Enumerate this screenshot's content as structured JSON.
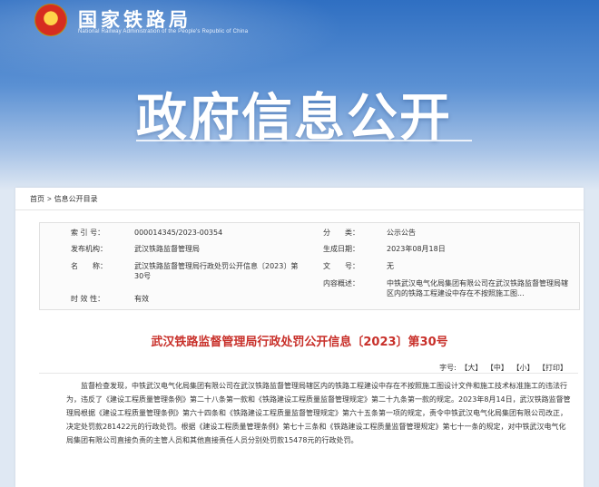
{
  "header": {
    "brand_cn": "国家铁路局",
    "brand_en": "National Railway Administration of the People's Republic of China",
    "page_title": "政府信息公开"
  },
  "breadcrumb": [
    "首页",
    ">",
    "信息公开目录"
  ],
  "meta": {
    "index_label": "索 引 号：",
    "index_value": "000014345/2023-00354",
    "category_label": "分　　类：",
    "category_value": "公示公告",
    "issuer_label": "发布机构：",
    "issuer_value": "武汉铁路监督管理局",
    "date_label": "生成日期：",
    "date_value": "2023年08月18日",
    "name_label": "名　　称：",
    "name_value": "武汉铁路监督管理局行政处罚公开信息〔2023〕第30号",
    "docno_label": "文　　号：",
    "docno_value": "无",
    "summary_label": "内容概述：",
    "summary_value": "中铁武汉电气化局集团有限公司在武汉铁路监督管理局辖区内的铁路工程建设中存在不按照施工图...",
    "validity_label": "时 效 性：",
    "validity_value": "有效"
  },
  "document": {
    "title": "武汉铁路监督管理局行政处罚公开信息〔2023〕第30号",
    "font_label": "字号:",
    "font_large": "【大】",
    "font_medium": "【中】",
    "font_small": "【小】",
    "print": "【打印】",
    "paragraph": "监督检查发现，中铁武汉电气化局集团有限公司在武汉铁路监督管理局辖区内的铁路工程建设中存在不按照施工图设计文件和施工技术标准施工的违法行为，违反了《建设工程质量管理条例》第二十八条第一款和《铁路建设工程质量监督管理规定》第二十九条第一款的规定。2023年8月14日，武汉铁路监督管理局根据《建设工程质量管理条例》第六十四条和《铁路建设工程质量监督管理规定》第六十五条第一项的规定，责令中铁武汉电气化局集团有限公司改正，决定处罚款281422元的行政处罚。根据《建设工程质量管理条例》第七十三条和《铁路建设工程质量监督管理规定》第七十一条的规定，对中铁武汉电气化局集团有限公司直接负责的主管人员和其他直接责任人员分别处罚款15478元的行政处罚。"
  },
  "colors": {
    "title_red": "#c8302a",
    "banner_blue": "#2f6fc2"
  },
  "icons": [
    "national-emblem-icon"
  ]
}
